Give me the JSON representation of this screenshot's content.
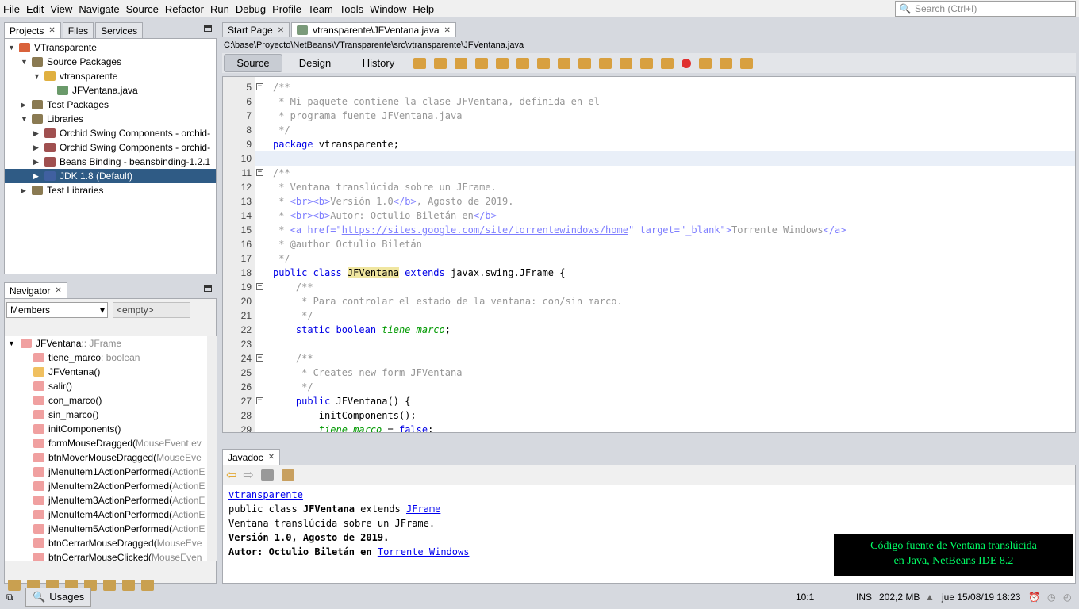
{
  "menu": [
    "File",
    "Edit",
    "View",
    "Navigate",
    "Source",
    "Refactor",
    "Run",
    "Debug",
    "Profile",
    "Team",
    "Tools",
    "Window",
    "Help"
  ],
  "search": {
    "placeholder": "Search (Ctrl+I)"
  },
  "projects": {
    "tabs": [
      "Projects",
      "Files",
      "Services"
    ],
    "tree": [
      {
        "label": "VTransparente",
        "indent": 0,
        "arrow": "▼",
        "color": "#d9623b"
      },
      {
        "label": "Source Packages",
        "indent": 1,
        "arrow": "▼",
        "color": "#8a7a52"
      },
      {
        "label": "vtransparente",
        "indent": 2,
        "arrow": "▼",
        "color": "#e0b040"
      },
      {
        "label": "JFVentana.java",
        "indent": 3,
        "arrow": "",
        "color": "#6a9a6a"
      },
      {
        "label": "Test Packages",
        "indent": 1,
        "arrow": "▶",
        "color": "#8a7a52"
      },
      {
        "label": "Libraries",
        "indent": 1,
        "arrow": "▼",
        "color": "#8a7a52"
      },
      {
        "label": "Orchid Swing Components - orchid-",
        "indent": 2,
        "arrow": "▶",
        "color": "#a05050"
      },
      {
        "label": "Orchid Swing Components - orchid-",
        "indent": 2,
        "arrow": "▶",
        "color": "#a05050"
      },
      {
        "label": "Beans Binding - beansbinding-1.2.1",
        "indent": 2,
        "arrow": "▶",
        "color": "#a05050"
      },
      {
        "label": "JDK 1.8 (Default)",
        "indent": 2,
        "arrow": "▶",
        "color": "#4060a0",
        "selected": true
      },
      {
        "label": "Test Libraries",
        "indent": 1,
        "arrow": "▶",
        "color": "#8a7a52"
      }
    ]
  },
  "navigator": {
    "title": "Navigator",
    "filter": "Members",
    "empty": "<empty>",
    "items": [
      {
        "name": "JFVentana",
        "type": " :: JFrame",
        "root": true
      },
      {
        "name": "tiene_marco",
        "type": " : boolean"
      },
      {
        "name": "JFVentana()",
        "type": ""
      },
      {
        "name": "salir()",
        "type": ""
      },
      {
        "name": "con_marco()",
        "type": ""
      },
      {
        "name": "sin_marco()",
        "type": ""
      },
      {
        "name": "initComponents()",
        "type": ""
      },
      {
        "name": "formMouseDragged(",
        "type": "MouseEvent ev"
      },
      {
        "name": "btnMoverMouseDragged(",
        "type": "MouseEve"
      },
      {
        "name": "jMenuItem1ActionPerformed(",
        "type": "ActionE"
      },
      {
        "name": "jMenuItem2ActionPerformed(",
        "type": "ActionE"
      },
      {
        "name": "jMenuItem3ActionPerformed(",
        "type": "ActionE"
      },
      {
        "name": "jMenuItem4ActionPerformed(",
        "type": "ActionE"
      },
      {
        "name": "jMenuItem5ActionPerformed(",
        "type": "ActionE"
      },
      {
        "name": "btnCerrarMouseDragged(",
        "type": "MouseEve"
      },
      {
        "name": "btnCerrarMouseClicked(",
        "type": "MouseEven"
      }
    ]
  },
  "editor": {
    "tabs": [
      "Start Page",
      "vtransparente\\JFVentana.java"
    ],
    "path": "C:\\base\\Proyecto\\NetBeans\\VTransparente\\src\\vtransparente\\JFVentana.java",
    "views": [
      "Source",
      "Design",
      "History"
    ],
    "lines": [
      {
        "n": "5",
        "fold": true,
        "tk": [
          [
            "/**",
            "c"
          ]
        ]
      },
      {
        "n": "6",
        "tk": [
          [
            " * Mi paquete contiene la clase JFVentana, definida en el",
            "c"
          ]
        ]
      },
      {
        "n": "7",
        "tk": [
          [
            " * programa fuente JFVentana.java",
            "c"
          ]
        ]
      },
      {
        "n": "8",
        "tk": [
          [
            " */",
            "c"
          ]
        ]
      },
      {
        "n": "9",
        "tk": [
          [
            "package",
            "k"
          ],
          [
            " vtransparente;",
            ""
          ]
        ]
      },
      {
        "n": "10",
        "tk": [],
        "current": true
      },
      {
        "n": "11",
        "fold": true,
        "tk": [
          [
            "/**",
            "c"
          ]
        ]
      },
      {
        "n": "12",
        "tk": [
          [
            " * Ventana translúcida sobre un JFrame.",
            "c"
          ]
        ]
      },
      {
        "n": "13",
        "tk": [
          [
            " * ",
            "c"
          ],
          [
            "<br><b>",
            "t"
          ],
          [
            "Versión 1.0",
            "c"
          ],
          [
            "</b>",
            "t"
          ],
          [
            ", Agosto de 2019.",
            "c"
          ]
        ]
      },
      {
        "n": "14",
        "tk": [
          [
            " * ",
            "c"
          ],
          [
            "<br><b>",
            "t"
          ],
          [
            "Autor: Octulio Biletán en",
            "c"
          ],
          [
            "</b>",
            "t"
          ]
        ]
      },
      {
        "n": "15",
        "tk": [
          [
            " * ",
            "c"
          ],
          [
            "<a href=\"",
            "t"
          ],
          [
            "https://sites.google.com/site/torrentewindows/home",
            "u"
          ],
          [
            "\" target=\"_blank\">",
            "t"
          ],
          [
            "Torrente Windows",
            "c"
          ],
          [
            "</a>",
            "t"
          ]
        ]
      },
      {
        "n": "16",
        "tk": [
          [
            " * @author Octulio Biletán",
            "c"
          ]
        ]
      },
      {
        "n": "17",
        "tk": [
          [
            " */",
            "c"
          ]
        ]
      },
      {
        "n": "18",
        "tk": [
          [
            "public class ",
            "k"
          ],
          [
            "JFVentana",
            "h"
          ],
          [
            " extends ",
            "k"
          ],
          [
            "javax.swing.JFrame {",
            ""
          ]
        ]
      },
      {
        "n": "19",
        "fold": true,
        "tk": [
          [
            "    /**",
            "c"
          ]
        ]
      },
      {
        "n": "20",
        "tk": [
          [
            "     * Para controlar el estado de la ventana: con/sin marco.",
            "c"
          ]
        ]
      },
      {
        "n": "21",
        "tk": [
          [
            "     */",
            "c"
          ]
        ]
      },
      {
        "n": "22",
        "tk": [
          [
            "    static boolean ",
            "k"
          ],
          [
            "tiene_marco",
            "f"
          ],
          [
            ";",
            ""
          ]
        ]
      },
      {
        "n": "23",
        "tk": []
      },
      {
        "n": "24",
        "fold": true,
        "tk": [
          [
            "    /**",
            "c"
          ]
        ]
      },
      {
        "n": "25",
        "tk": [
          [
            "     * Creates new form JFVentana",
            "c"
          ]
        ]
      },
      {
        "n": "26",
        "tk": [
          [
            "     */",
            "c"
          ]
        ]
      },
      {
        "n": "27",
        "fold": true,
        "tk": [
          [
            "    public ",
            "k"
          ],
          [
            "JFVentana",
            ""
          ],
          [
            "() {",
            ""
          ]
        ]
      },
      {
        "n": "28",
        "tk": [
          [
            "        initComponents();",
            ""
          ]
        ]
      },
      {
        "n": "29",
        "tk": [
          [
            "        ",
            ""
          ],
          [
            "tiene_marco",
            "f"
          ],
          [
            " = ",
            ""
          ],
          [
            "false",
            "k"
          ],
          [
            ";",
            ""
          ]
        ]
      }
    ]
  },
  "javadoc": {
    "title": "Javadoc",
    "package": "vtransparente",
    "decl_prefix": "public class ",
    "decl_class": "JFVentana",
    "decl_mid": " extends ",
    "decl_link": "JFrame",
    "l3": "Ventana translúcida sobre un JFrame.",
    "l4": "Versión 1.0, Agosto de 2019.",
    "l5_prefix": "Autor: Octulio Biletán en ",
    "l5_link": "Torrente Windows"
  },
  "caption": {
    "line1": "Código fuente de Ventana translúcida",
    "line2": "en Java, NetBeans IDE 8.2",
    "color": "#00ff66"
  },
  "status": {
    "usages": "Usages",
    "position": "10:1",
    "mode": "INS",
    "memory": "202,2 MB",
    "datetime": "jue 15/08/19 18:23"
  }
}
